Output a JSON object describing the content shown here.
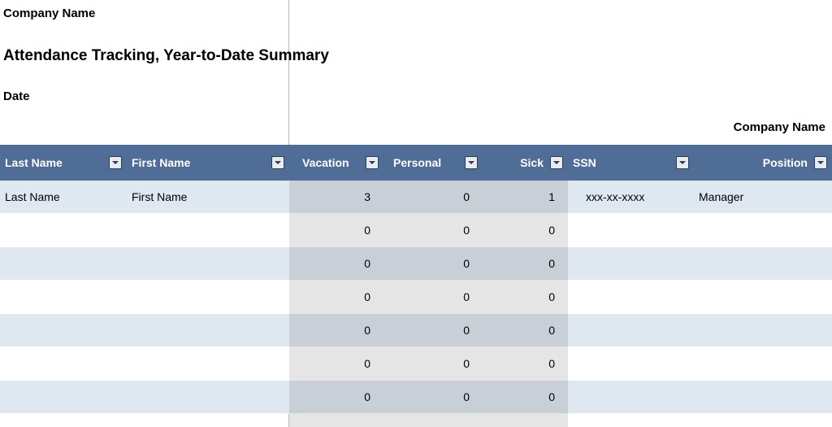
{
  "header": {
    "company_label": "Company Name",
    "title": "Attendance Tracking, Year-to-Date Summary",
    "date_label": "Date",
    "company_right": "Company Name"
  },
  "columns": {
    "last_name": "Last Name",
    "first_name": "First Name",
    "vacation": "Vacation",
    "personal": "Personal",
    "sick": "Sick",
    "ssn": "SSN",
    "position": "Position"
  },
  "rows": [
    {
      "last_name": "Last Name",
      "first_name": "First Name",
      "vacation": "3",
      "personal": "0",
      "sick": "1",
      "ssn": "xxx-xx-xxxx",
      "position": "Manager"
    },
    {
      "last_name": "",
      "first_name": "",
      "vacation": "0",
      "personal": "0",
      "sick": "0",
      "ssn": "",
      "position": ""
    },
    {
      "last_name": "",
      "first_name": "",
      "vacation": "0",
      "personal": "0",
      "sick": "0",
      "ssn": "",
      "position": ""
    },
    {
      "last_name": "",
      "first_name": "",
      "vacation": "0",
      "personal": "0",
      "sick": "0",
      "ssn": "",
      "position": ""
    },
    {
      "last_name": "",
      "first_name": "",
      "vacation": "0",
      "personal": "0",
      "sick": "0",
      "ssn": "",
      "position": ""
    },
    {
      "last_name": "",
      "first_name": "",
      "vacation": "0",
      "personal": "0",
      "sick": "0",
      "ssn": "",
      "position": ""
    },
    {
      "last_name": "",
      "first_name": "",
      "vacation": "0",
      "personal": "0",
      "sick": "0",
      "ssn": "",
      "position": ""
    }
  ],
  "colors": {
    "header_bg": "#4f6d96",
    "row_alt_bg": "#dfe7f0",
    "gray_overlay": "rgba(0,0,0,0.10)"
  }
}
